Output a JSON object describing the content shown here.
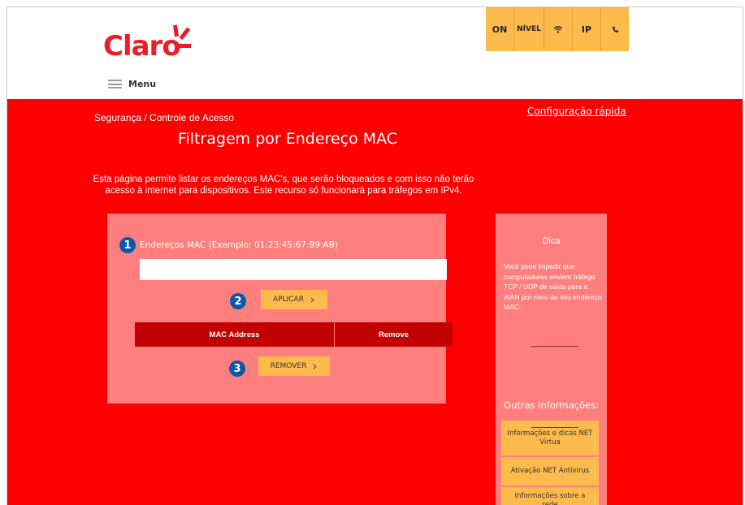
{
  "header": {
    "logo_text": "Claro",
    "menu_label": "Menu",
    "status_buttons": {
      "on": "ON",
      "nivel": "NÍVEL",
      "wifi_icon": "wifi-icon",
      "ip": "IP",
      "phone_icon": "phone-icon"
    }
  },
  "main": {
    "breadcrumb": "Segurança / Controle de Acesso",
    "quick_config": "Configuração rápida",
    "title": "Filtragem por Endereço MAC",
    "description": "Esta página permite listar os endereços MAC's, que serão bloqueados e com isso não terão acesso à internet para dispositivos. Este recurso só funcionará para tráfegos em IPv4."
  },
  "form": {
    "step1": "1",
    "step2": "2",
    "step3": "3",
    "mac_label": "Endereços MAC (Exemplo: 01:23:45:67:89:AB)",
    "mac_value": "",
    "apply_label": "APLICAR",
    "remove_label": "REMOVER",
    "table_headers": [
      "MAC Address",
      "Remove"
    ]
  },
  "sidebar": {
    "tip_title": "Dica",
    "tip_text": "Você pode impedir que computadores enviem tráfego TCP / UDP de saída para a WAN por meio de seu endereço MAC.",
    "other_title": "Outras informações:",
    "links": [
      "Informações e dicas NET Virtua",
      "Ativação NET Antivirus",
      "Informações sobre a rede"
    ]
  },
  "colors": {
    "brand_red": "#ff0000",
    "panel_pink": "#ff7f7f",
    "accent_yellow": "#fdbb4d",
    "table_header": "#c10000",
    "badge_blue": "#0b58a8"
  }
}
